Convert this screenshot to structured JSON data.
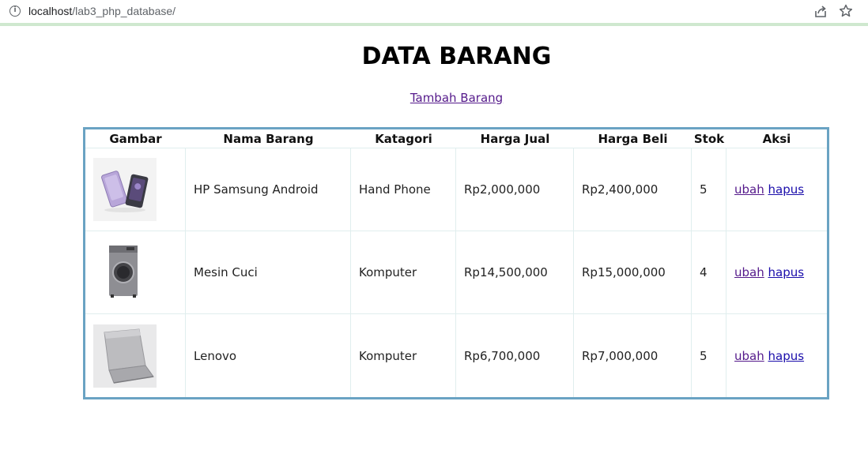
{
  "browser": {
    "url_host": "localhost",
    "url_path": "/lab3_php_database/"
  },
  "page": {
    "title": "DATA BARANG",
    "add_link": "Tambah Barang"
  },
  "table": {
    "headers": [
      "Gambar",
      "Nama Barang",
      "Katagori",
      "Harga Jual",
      "Harga Beli",
      "Stok",
      "Aksi"
    ],
    "rows": [
      {
        "image": "phone-image",
        "nama": "HP Samsung Android",
        "kategori": "Hand Phone",
        "harga_jual": "Rp2,000,000",
        "harga_beli": "Rp2,400,000",
        "stok": "5",
        "edit": "ubah",
        "delete": "hapus"
      },
      {
        "image": "washing-machine-image",
        "nama": "Mesin Cuci",
        "kategori": "Komputer",
        "harga_jual": "Rp14,500,000",
        "harga_beli": "Rp15,000,000",
        "stok": "4",
        "edit": "ubah",
        "delete": "hapus"
      },
      {
        "image": "laptop-image",
        "nama": "Lenovo",
        "kategori": "Komputer",
        "harga_jual": "Rp6,700,000",
        "harga_beli": "Rp7,000,000",
        "stok": "5",
        "edit": "ubah",
        "delete": "hapus"
      }
    ]
  },
  "colors": {
    "table_border": "#6aa3c3",
    "visited_link": "#551a8b",
    "link": "#1a0dab"
  }
}
